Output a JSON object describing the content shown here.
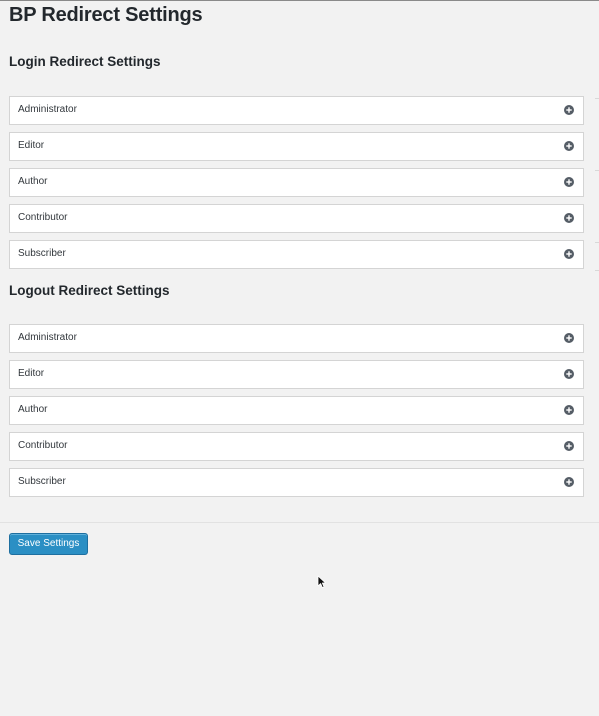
{
  "page": {
    "title": "BP Redirect Settings"
  },
  "login_section": {
    "title": "Login Redirect Settings",
    "roles": [
      "Administrator",
      "Editor",
      "Author",
      "Contributor",
      "Subscriber"
    ]
  },
  "logout_section": {
    "title": "Logout Redirect Settings",
    "roles": [
      "Administrator",
      "Editor",
      "Author",
      "Contributor",
      "Subscriber"
    ]
  },
  "actions": {
    "save_label": "Save Settings"
  },
  "icons": {
    "expand": "plus-circle-icon",
    "cursor": "mouse-pointer-icon"
  },
  "colors": {
    "button_bg": "#2b8fc4",
    "page_bg": "#f2f2f2"
  }
}
